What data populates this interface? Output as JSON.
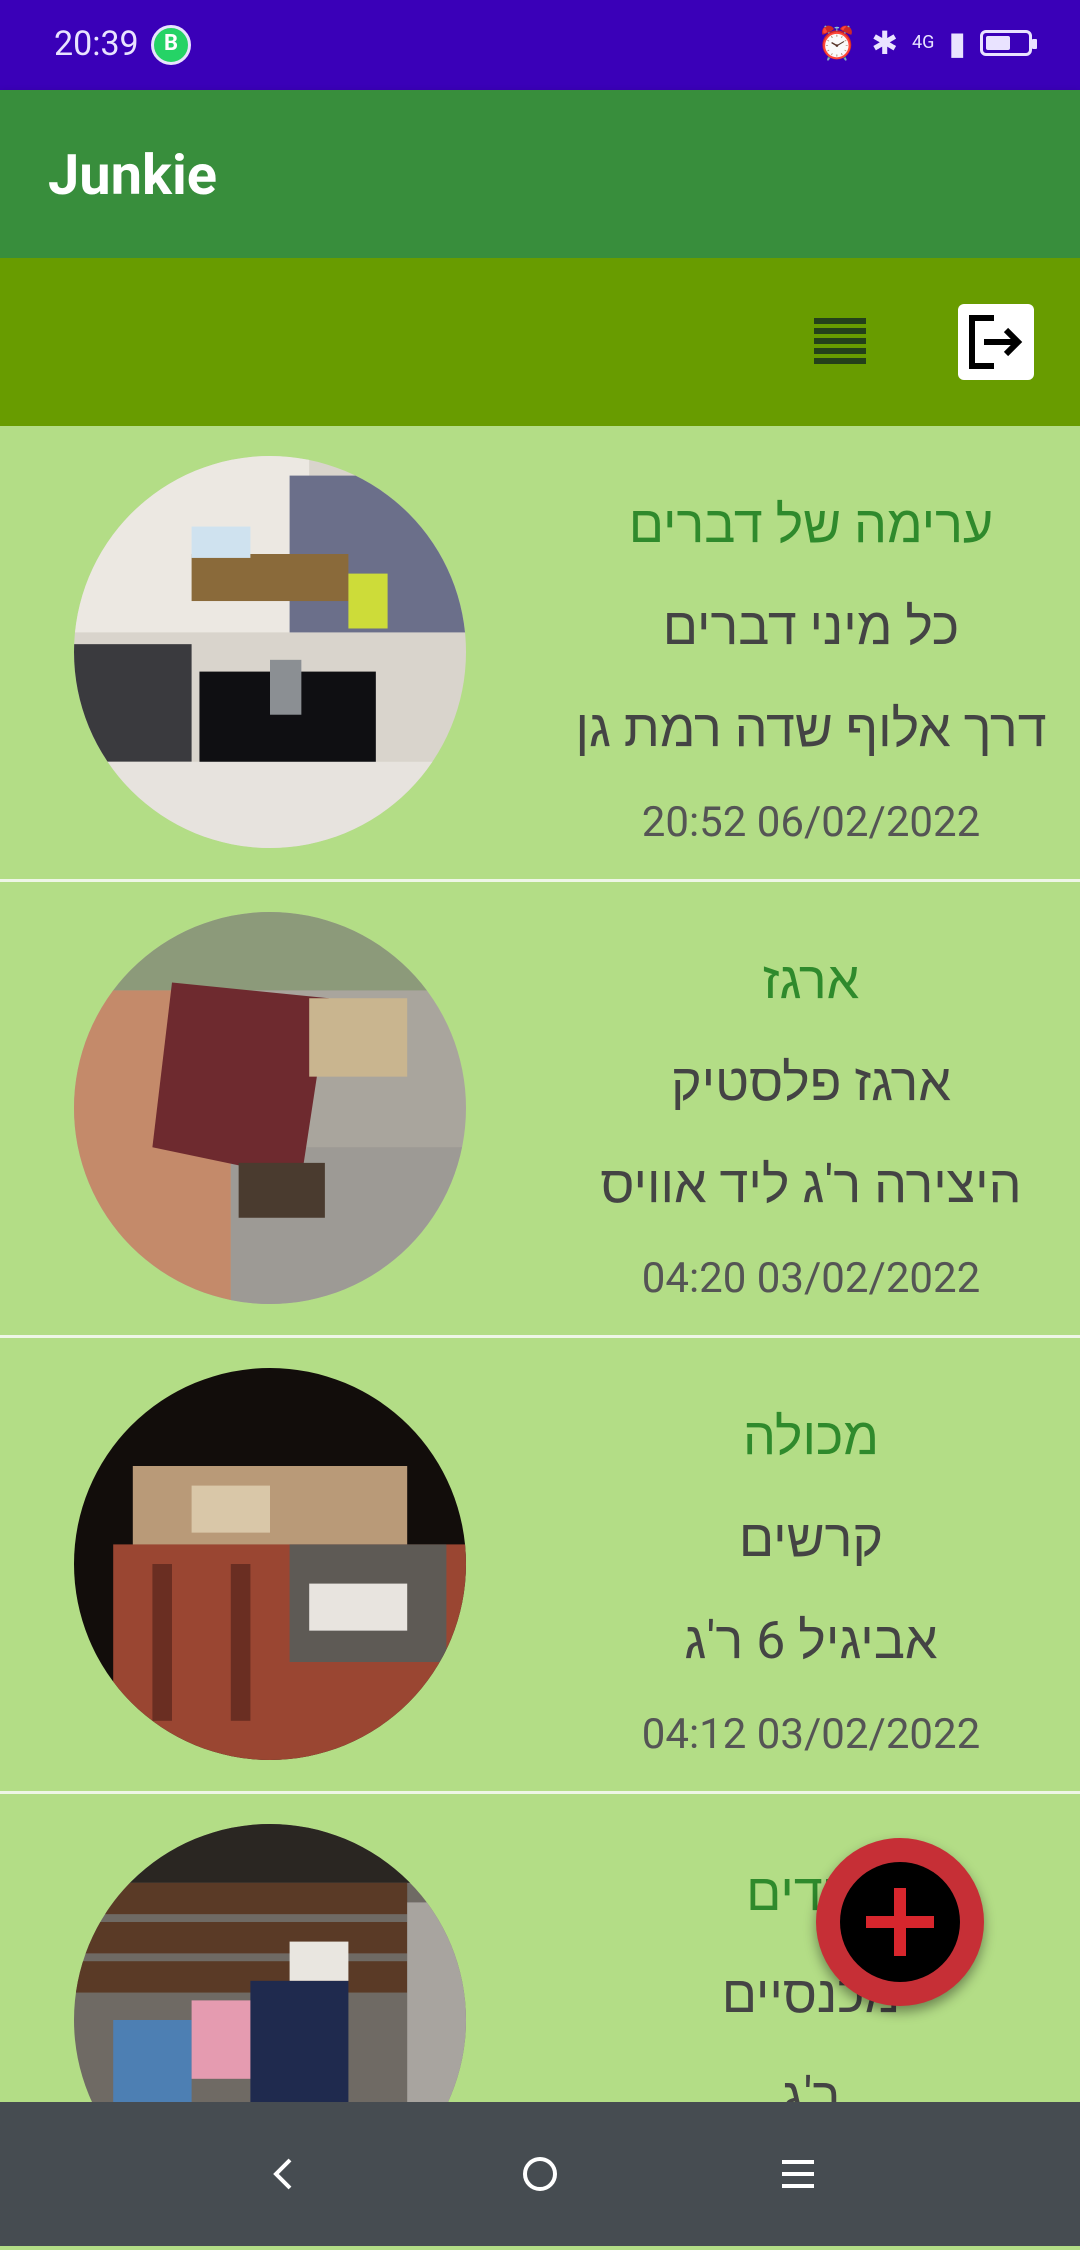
{
  "status_bar": {
    "time": "20:39",
    "network": "4G"
  },
  "app_bar": {
    "title": "Junkie"
  },
  "toolbar": {
    "view_icon": "list-view-icon",
    "logout_icon": "logout-icon"
  },
  "items": [
    {
      "title": "ערימה של דברים",
      "description": "כל מיני דברים",
      "address": "דרך אלוף שדה רמת גן",
      "date": "06/02/2022 20:52"
    },
    {
      "title": "ארגז",
      "description": "ארגז פלסטיק",
      "address": "היצירה ר'ג ליד אוויס",
      "date": "03/02/2022 04:20"
    },
    {
      "title": "מכולה",
      "description": "קרשים",
      "address": "אביגיל 6 ר'ג",
      "date": "03/02/2022 04:12"
    },
    {
      "title": "בגדים",
      "description": "מכנסיים",
      "address": "ר'ג",
      "date": ""
    }
  ],
  "colors": {
    "status_bar": "#3a00b8",
    "app_bar": "#388e3c",
    "toolbar": "#689c00",
    "list_bg": "#b3dd86",
    "title_text": "#2f8a2c",
    "fab": "#c62f36"
  }
}
